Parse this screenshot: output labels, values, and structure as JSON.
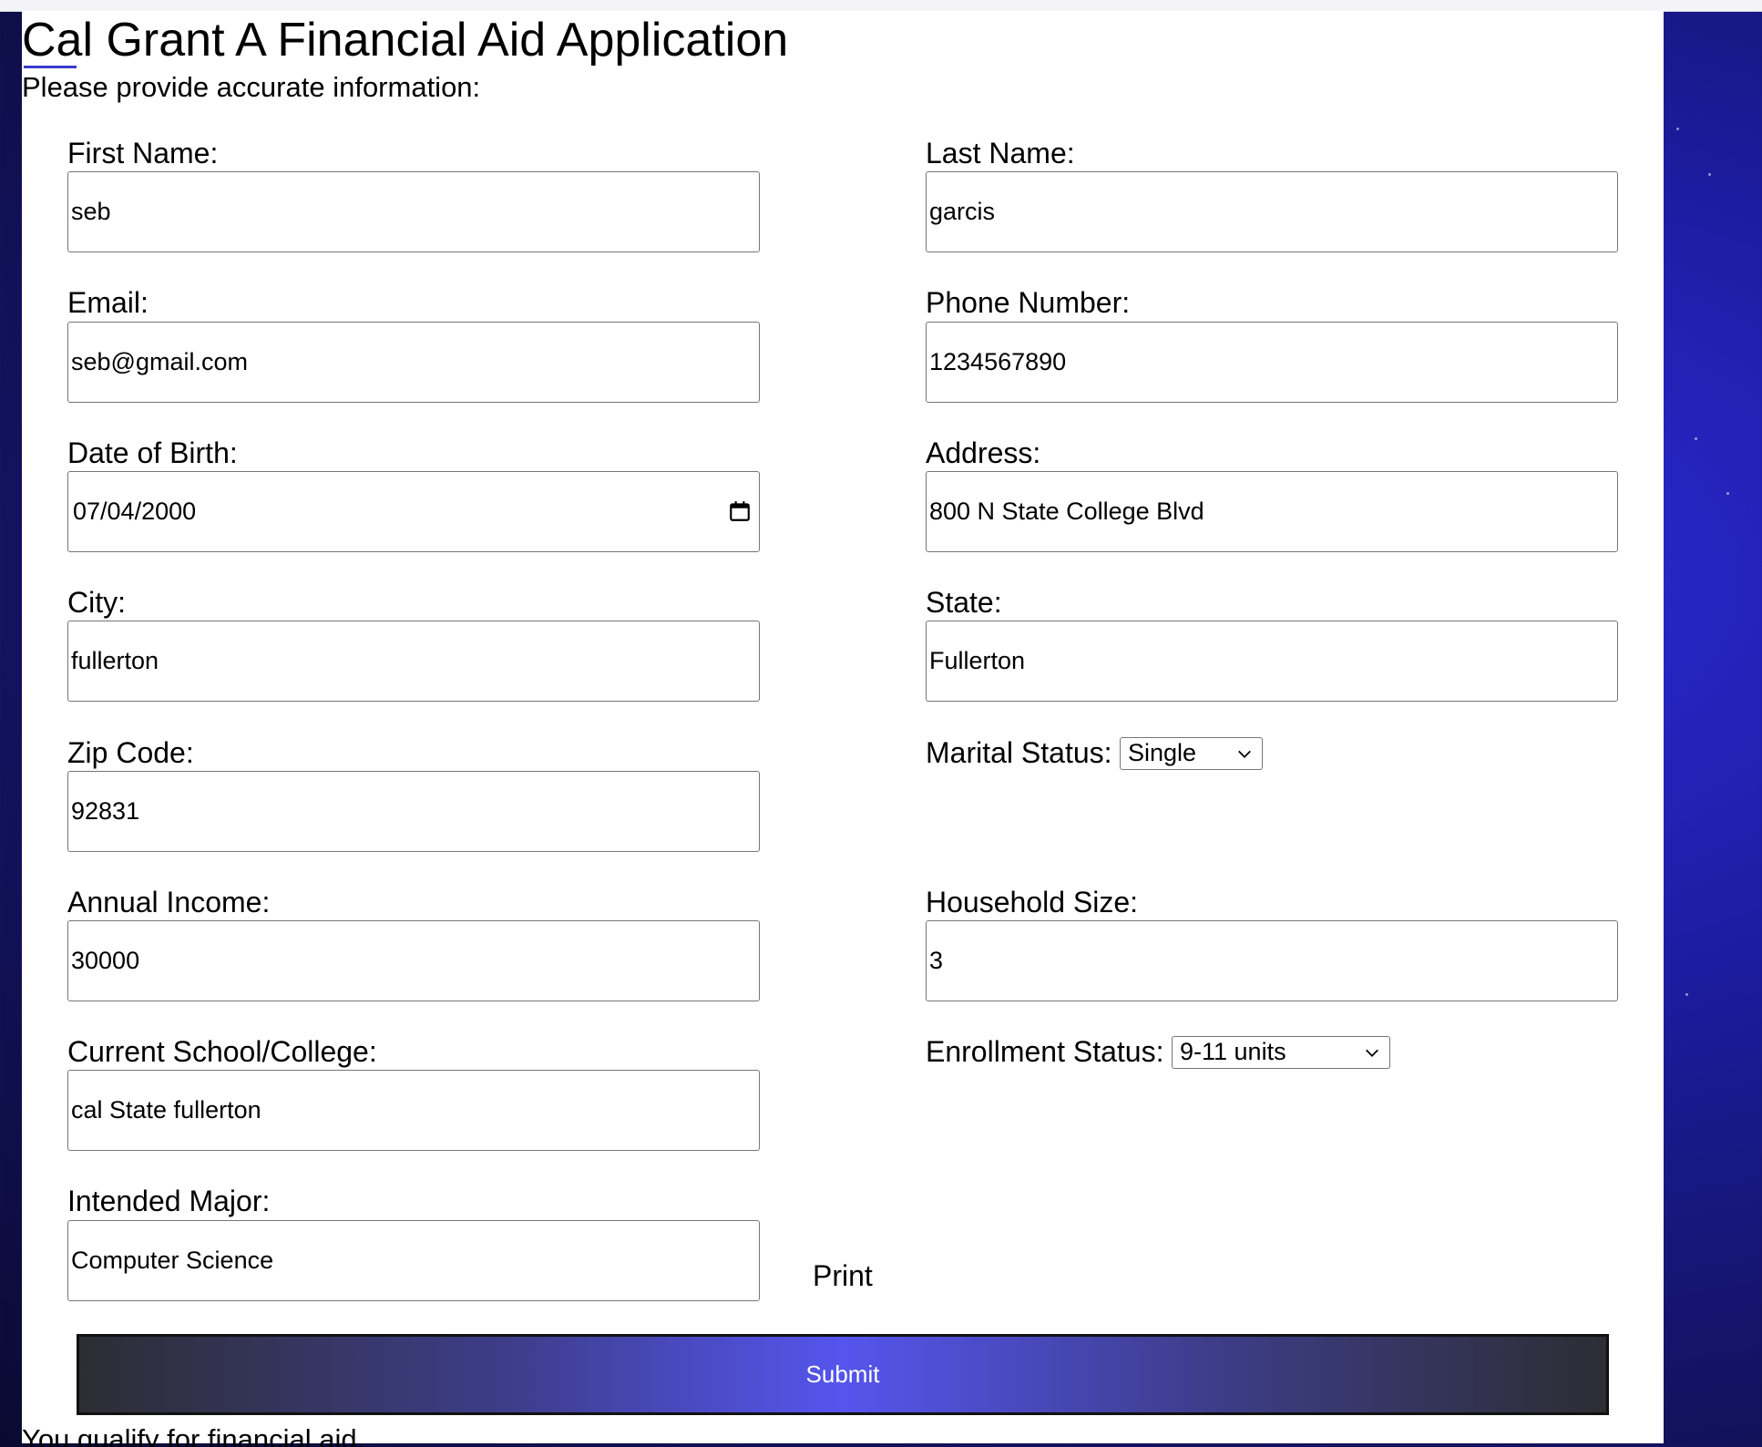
{
  "page": {
    "title": "Cal Grant A Financial Aid Application",
    "subtitle": "Please provide accurate information:"
  },
  "form": {
    "first_name": {
      "label": "First Name:",
      "value": "seb"
    },
    "last_name": {
      "label": "Last Name:",
      "value": "garcis"
    },
    "email": {
      "label": "Email:",
      "value": "seb@gmail.com"
    },
    "phone": {
      "label": "Phone Number:",
      "value": "1234567890"
    },
    "dob": {
      "label": "Date of Birth:",
      "value": "07/04/2000"
    },
    "address": {
      "label": "Address:",
      "value": "800 N State College Blvd"
    },
    "city": {
      "label": "City:",
      "value": "fullerton"
    },
    "state": {
      "label": "State:",
      "value": "Fullerton"
    },
    "zip": {
      "label": "Zip Code:",
      "value": "92831"
    },
    "marital_status": {
      "label": "Marital Status:",
      "selected": "Single"
    },
    "annual_income": {
      "label": "Annual Income:",
      "value": "30000"
    },
    "household_size": {
      "label": "Household Size:",
      "value": "3"
    },
    "school": {
      "label": "Current School/College:",
      "value": "cal State fullerton"
    },
    "enrollment_status": {
      "label": "Enrollment Status:",
      "selected": "9-11 units"
    },
    "major": {
      "label": "Intended Major:",
      "value": "Computer Science"
    }
  },
  "actions": {
    "print_label": "Print",
    "submit_label": "Submit"
  },
  "result": {
    "message": "You qualify for financial aid."
  },
  "icons": {
    "date": "calendar-icon",
    "dropdown": "chevron-down-icon"
  }
}
